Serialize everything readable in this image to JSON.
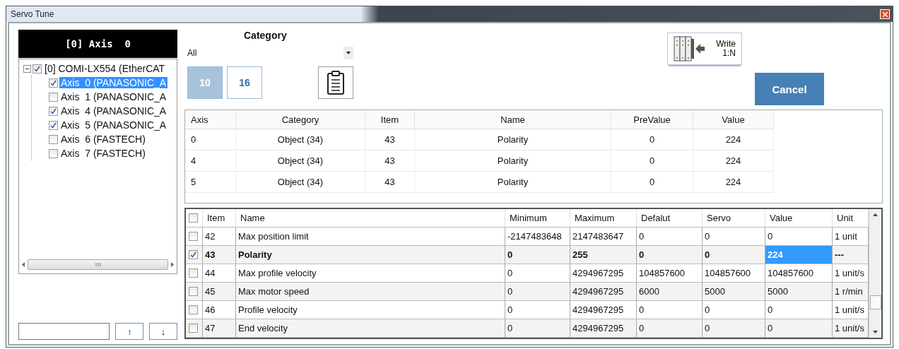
{
  "window": {
    "title": "Servo Tune"
  },
  "axis_header": "[0] Axis  0",
  "tree": [
    {
      "label": "[0] COMI-LX554 (EtherCAT",
      "checked": true,
      "selected": false,
      "expanded": true,
      "children": [
        {
          "label": "Axis  0 (PANASONIC_A",
          "checked": true,
          "selected": true
        },
        {
          "label": "Axis  1 (PANASONIC_A",
          "checked": false,
          "selected": false
        },
        {
          "label": "Axis  4 (PANASONIC_A",
          "checked": true,
          "selected": false
        },
        {
          "label": "Axis  5 (PANASONIC_A",
          "checked": true,
          "selected": false
        },
        {
          "label": "Axis  6 (FASTECH)",
          "checked": false,
          "selected": false
        },
        {
          "label": "Axis  7 (FASTECH)",
          "checked": false,
          "selected": false
        }
      ]
    }
  ],
  "nav_buttons": [
    "↑",
    "↓"
  ],
  "category": {
    "label": "Category",
    "value": "All"
  },
  "radix_buttons": [
    {
      "label": "10",
      "selected": true
    },
    {
      "label": "16",
      "selected": false
    }
  ],
  "write_button": {
    "lines": [
      "Write",
      "1:N"
    ]
  },
  "cancel_button": "Cancel",
  "changes_table": {
    "columns": [
      "Axis",
      "Category",
      "Item",
      "Name",
      "PreValue",
      "Value"
    ],
    "rows": [
      [
        "0",
        "Object (34)",
        "43",
        "Polarity",
        "0",
        "224"
      ],
      [
        "4",
        "Object (34)",
        "43",
        "Polarity",
        "0",
        "224"
      ],
      [
        "5",
        "Object (34)",
        "43",
        "Polarity",
        "0",
        "224"
      ]
    ]
  },
  "params_table": {
    "header_checked": false,
    "columns": [
      "Item",
      "Name",
      "Minimum",
      "Maximum",
      "Defalut",
      "Servo",
      "Value",
      "Unit"
    ],
    "rows": [
      {
        "checked": false,
        "selected": false,
        "cells": [
          "42",
          "Max position limit",
          "-2147483648",
          "2147483647",
          "0",
          "0",
          "0",
          "1 unit"
        ]
      },
      {
        "checked": true,
        "selected": true,
        "cells": [
          "43",
          "Polarity",
          "0",
          "255",
          "0",
          "0",
          "224",
          "---"
        ]
      },
      {
        "checked": false,
        "selected": false,
        "cells": [
          "44",
          "Max profile velocity",
          "0",
          "4294967295",
          "104857600",
          "104857600",
          "104857600",
          "1 unit/s"
        ]
      },
      {
        "checked": false,
        "selected": false,
        "cells": [
          "45",
          "Max motor speed",
          "0",
          "4294967295",
          "6000",
          "5000",
          "5000",
          "1 r/min"
        ]
      },
      {
        "checked": false,
        "selected": false,
        "cells": [
          "46",
          "Profile velocity",
          "0",
          "4294967295",
          "0",
          "0",
          "0",
          "1 unit/s"
        ]
      },
      {
        "checked": false,
        "selected": false,
        "cells": [
          "47",
          "End velocity",
          "0",
          "4294967295",
          "0",
          "0",
          "0",
          "1 unit/s"
        ]
      }
    ]
  }
}
